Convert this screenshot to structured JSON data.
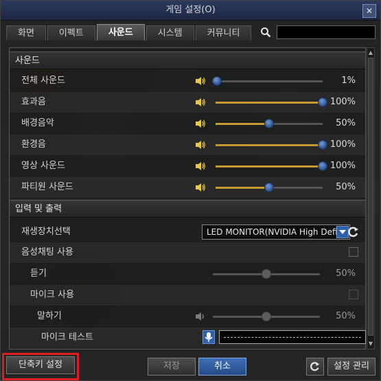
{
  "window": {
    "title": "게임 설정(O)"
  },
  "tabs": [
    {
      "label": "화면",
      "active": false
    },
    {
      "label": "이펙트",
      "active": false
    },
    {
      "label": "사운드",
      "active": true
    },
    {
      "label": "시스템",
      "active": false
    },
    {
      "label": "커뮤니티",
      "active": false
    }
  ],
  "search": {
    "placeholder": ""
  },
  "sound_section": {
    "title": "사운드",
    "rows": [
      {
        "label": "전체 사운드",
        "value": 1,
        "display": "1%"
      },
      {
        "label": "효과음",
        "value": 100,
        "display": "100%"
      },
      {
        "label": "배경음악",
        "value": 50,
        "display": "50%"
      },
      {
        "label": "환경음",
        "value": 100,
        "display": "100%"
      },
      {
        "label": "영상 사운드",
        "value": 100,
        "display": "100%"
      },
      {
        "label": "파티원 사운드",
        "value": 50,
        "display": "50%"
      }
    ]
  },
  "io_section": {
    "title": "입력 및 출력",
    "playback_label": "재생장치선택",
    "playback_device": "LED MONITOR(NVIDIA High Defin...",
    "voice_chat_label": "음성채팅 사용",
    "listen_label": "듣기",
    "listen_value": 50,
    "listen_display": "50%",
    "mic_use_label": "마이크 사용",
    "speak_label": "말하기",
    "speak_value": 50,
    "speak_display": "50%",
    "mic_test_label": "마이크 테스트"
  },
  "footer": {
    "shortcut_label": "단축키 설정",
    "save_label": "저장",
    "cancel_label": "취소",
    "manage_label": "설정 관리"
  },
  "colors": {
    "accent": "#2f5fa8",
    "slider_fill": "#c79a38",
    "highlight": "#e01b24"
  }
}
